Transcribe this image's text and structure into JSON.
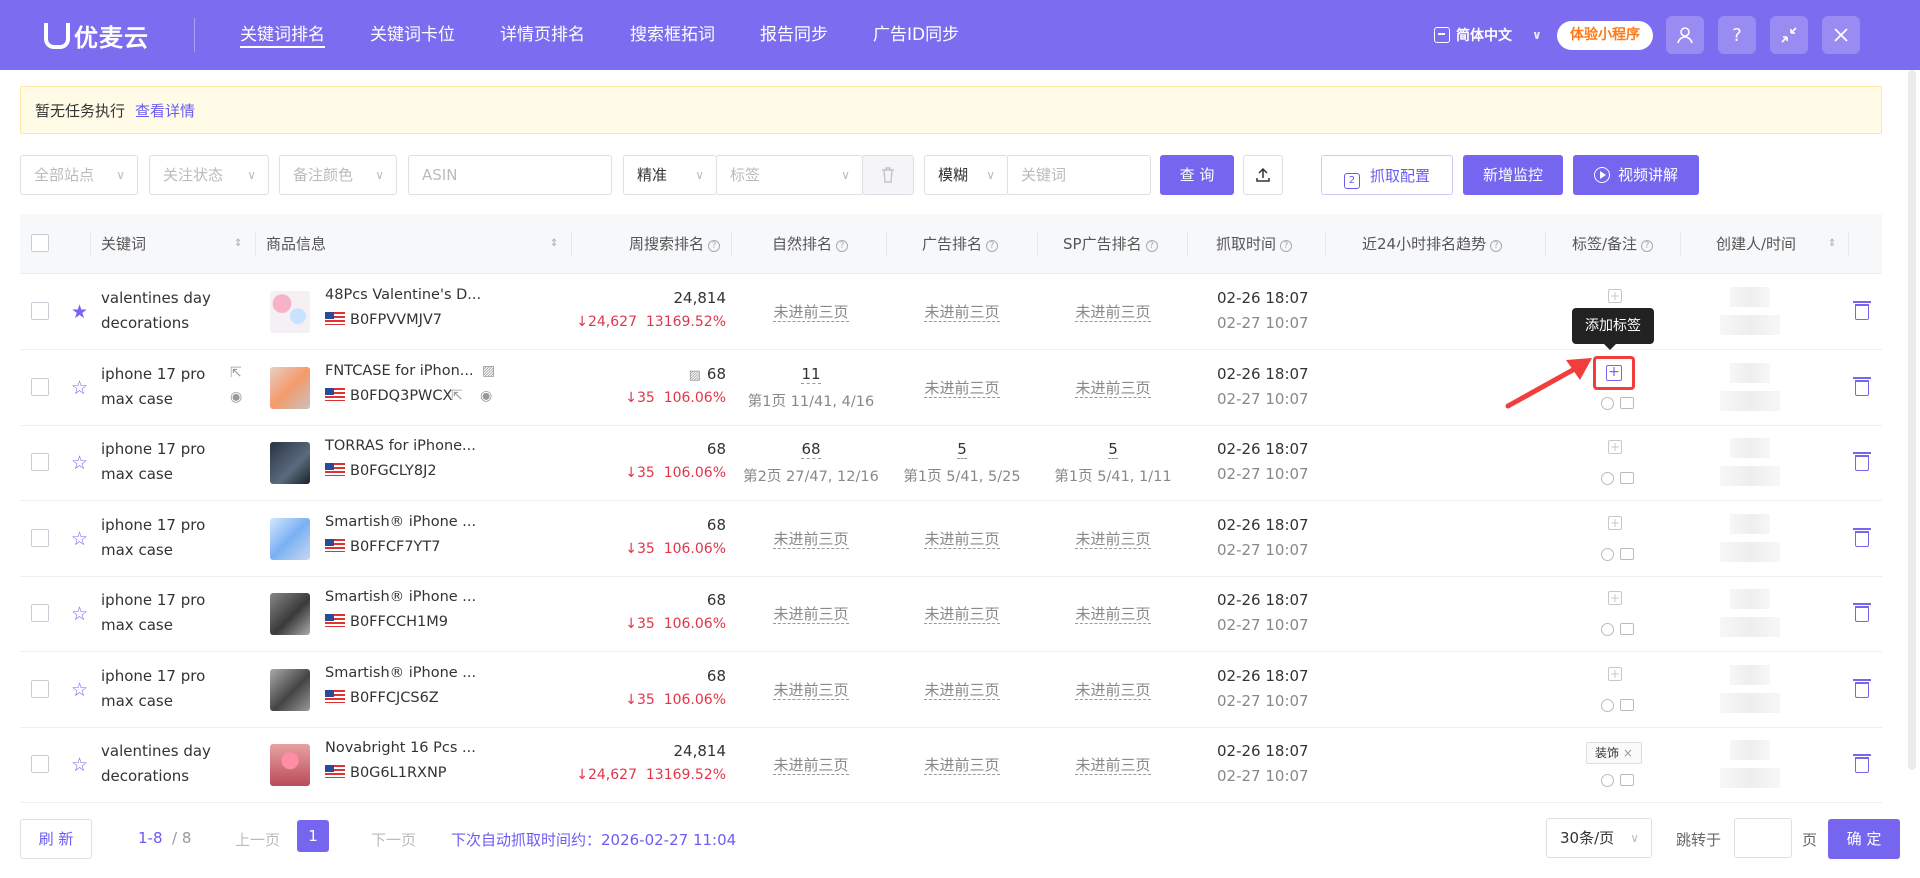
{
  "app": {
    "brand": "优麦云"
  },
  "nav": [
    "关键词排名",
    "关键词卡位",
    "详情页排名",
    "搜索框拓词",
    "报告同步",
    "广告ID同步"
  ],
  "header": {
    "language": "简体中文",
    "miniapp": "体验小程序",
    "icons": [
      "user-icon",
      "help-icon",
      "collapse-icon",
      "close-icon"
    ]
  },
  "notice": {
    "text": "暂无任务执行",
    "link": "查看详情"
  },
  "filters": {
    "site": "全部站点",
    "follow": "关注状态",
    "color": "备注颜色",
    "asin_placeholder": "ASIN",
    "match1": "精准",
    "tag_placeholder": "标签",
    "match2": "模糊",
    "keyword_placeholder": "关键词",
    "query": "查 询",
    "fetch_config": "抓取配置",
    "fetch_config_num": "2",
    "add_monitor": "新增监控",
    "video": "视频讲解"
  },
  "table": {
    "headers": {
      "keyword": "关键词",
      "product": "商品信息",
      "weekly": "周搜索排名",
      "natural": "自然排名",
      "ad": "广告排名",
      "sp": "SP广告排名",
      "fetch": "抓取时间",
      "trend": "近24小时排名趋势",
      "tag": "标签/备注",
      "creator": "创建人/时间"
    },
    "rows": [
      {
        "kw1": "valentines day",
        "kw2": "decorations",
        "title": "48Pcs Valentine's D...",
        "asin": "B0FPVVMJV7",
        "weekly": "24,814",
        "change": "↓24,627",
        "pct": "13169.52%",
        "natural": "未进前三页",
        "natural_sub": "",
        "ad": "未进前三页",
        "ad_sub": "",
        "sp": "未进前三页",
        "sp_sub": "",
        "t1": "02-26 18:07",
        "t2": "02-27 10:07"
      },
      {
        "kw1": "iphone 17 pro",
        "kw2": "max case",
        "title": "FNTCASE for iPhon...",
        "asin": "B0FDQ3PWCX",
        "weekly": "68",
        "change": "↓35",
        "pct": "106.06%",
        "natural": "11",
        "natural_sub": "第1页 11/41, 4/16",
        "ad": "未进前三页",
        "ad_sub": "",
        "sp": "未进前三页",
        "sp_sub": "",
        "t1": "02-26 18:07",
        "t2": "02-27 10:07"
      },
      {
        "kw1": "iphone 17 pro",
        "kw2": "max case",
        "title": "TORRAS for iPhone...",
        "asin": "B0FGCLY8J2",
        "weekly": "68",
        "change": "↓35",
        "pct": "106.06%",
        "natural": "68",
        "natural_sub": "第2页 27/47, 12/16",
        "ad": "5",
        "ad_sub": "第1页 5/41, 5/25",
        "sp": "5",
        "sp_sub": "第1页 5/41, 1/11",
        "t1": "02-26 18:07",
        "t2": "02-27 10:07"
      },
      {
        "kw1": "iphone 17 pro",
        "kw2": "max case",
        "title": "Smartish® iPhone ...",
        "asin": "B0FFCF7YT7",
        "weekly": "68",
        "change": "↓35",
        "pct": "106.06%",
        "natural": "未进前三页",
        "natural_sub": "",
        "ad": "未进前三页",
        "ad_sub": "",
        "sp": "未进前三页",
        "sp_sub": "",
        "t1": "02-26 18:07",
        "t2": "02-27 10:07"
      },
      {
        "kw1": "iphone 17 pro",
        "kw2": "max case",
        "title": "Smartish® iPhone ...",
        "asin": "B0FFCCH1M9",
        "weekly": "68",
        "change": "↓35",
        "pct": "106.06%",
        "natural": "未进前三页",
        "natural_sub": "",
        "ad": "未进前三页",
        "ad_sub": "",
        "sp": "未进前三页",
        "sp_sub": "",
        "t1": "02-26 18:07",
        "t2": "02-27 10:07"
      },
      {
        "kw1": "iphone 17 pro",
        "kw2": "max case",
        "title": "Smartish® iPhone ...",
        "asin": "B0FFCJCS6Z",
        "weekly": "68",
        "change": "↓35",
        "pct": "106.06%",
        "natural": "未进前三页",
        "natural_sub": "",
        "ad": "未进前三页",
        "ad_sub": "",
        "sp": "未进前三页",
        "sp_sub": "",
        "t1": "02-26 18:07",
        "t2": "02-27 10:07"
      },
      {
        "kw1": "valentines day",
        "kw2": "decorations",
        "title": "Novabright 16 Pcs ...",
        "asin": "B0G6L1RXNP",
        "weekly": "24,814",
        "change": "↓24,627",
        "pct": "13169.52%",
        "natural": "未进前三页",
        "natural_sub": "",
        "ad": "未进前三页",
        "ad_sub": "",
        "sp": "未进前三页",
        "sp_sub": "",
        "t1": "02-26 18:07",
        "t2": "02-27 10:07"
      }
    ]
  },
  "tooltip": "添加标签",
  "tag_chip": "装饰",
  "footer": {
    "refresh": "刷 新",
    "range": "1-8",
    "total": "/ 8",
    "prev": "上一页",
    "page": "1",
    "next": "下一页",
    "auto_fetch": "下次自动抓取时间约：2026-02-27 11:04",
    "page_size": "30条/页",
    "jump": "跳转于",
    "page_unit": "页",
    "confirm": "确 定"
  }
}
